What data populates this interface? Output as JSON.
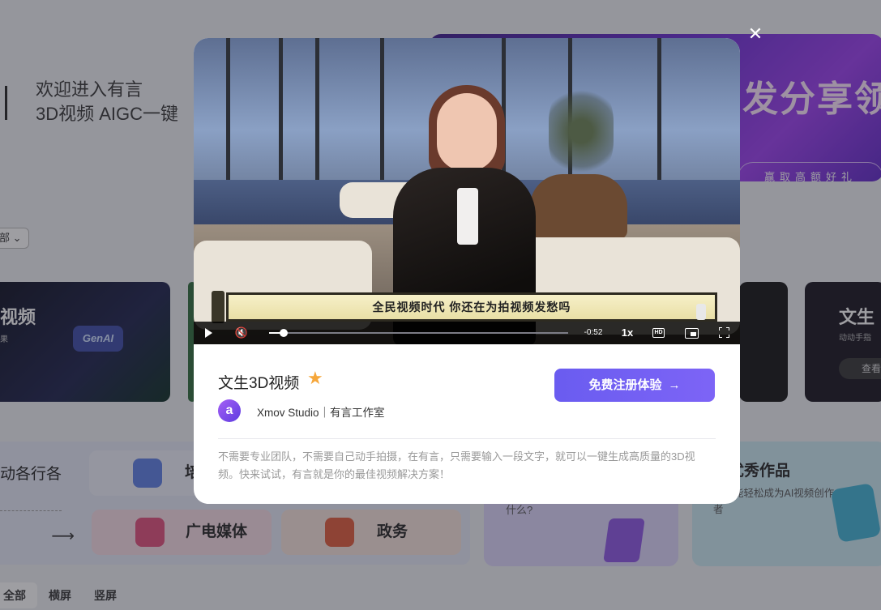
{
  "background": {
    "welcome_line1": "欢迎进入有言",
    "welcome_line2": "3D视频 AIGC一键",
    "banner_title": "转发分享领",
    "banner_sub": "赢取高额好礼",
    "filter_label": "部",
    "card_a": {
      "title": "视频",
      "tag": "GenAI",
      "desc": "果"
    },
    "card_d": {
      "title": "文生",
      "desc": "动动手指",
      "button": "查看"
    },
    "industries_title": "动各行各",
    "industry_items": [
      "培",
      "广电媒体",
      "政务"
    ],
    "purple_text": "什么?",
    "teal_title": "人优秀作品",
    "teal_desc": "人都能轻松成为AI视频创作者",
    "view_tabs": [
      "全部",
      "横屏",
      "竖屏"
    ]
  },
  "modal": {
    "close_icon": "close-icon",
    "video": {
      "subtitle": "全民视频时代 你还在为拍视频发愁吗",
      "time": "-0:52",
      "speed": "1x",
      "hd_label": "HD",
      "progress": 0.05
    },
    "title": "文生3D视频",
    "title_icon": "star-icon",
    "studio_logo": "a",
    "studio_name": "Xmov Studio｜有言工作室",
    "cta_label": "免费注册体验",
    "cta_arrow": "→",
    "description": "不需要专业团队，不需要自己动手拍摄，在有言，只需要输入一段文字，就可以一键生成高质量的3D视频。快来试试，有言就是你的最佳视频解决方案！"
  }
}
